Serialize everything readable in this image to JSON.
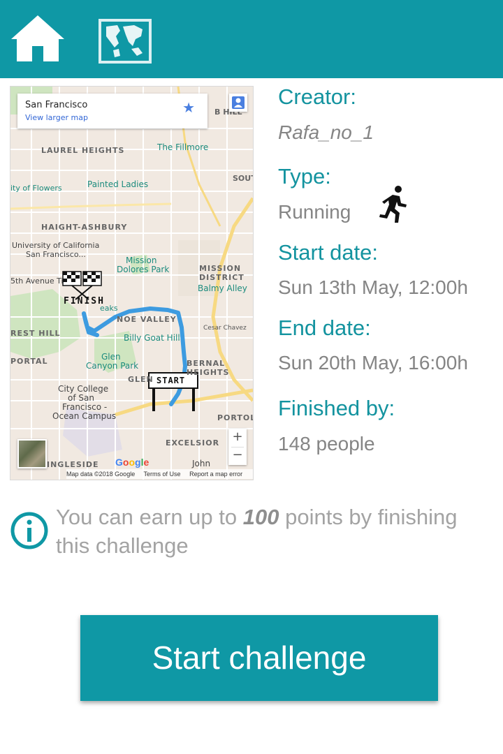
{
  "nav": {
    "home_icon": "home-icon",
    "map_icon": "world-map-icon"
  },
  "map": {
    "place_name": "San Francisco",
    "larger_map_link": "View larger map",
    "google_logo": "Google",
    "footer": {
      "data": "Map data ©2018 Google",
      "terms": "Terms of Use",
      "report": "Report a map error"
    },
    "labels": {
      "laurel_heights": "LAUREL HEIGHTS",
      "the_fillmore": "The Fillmore",
      "hill": "B HILL",
      "city_of_flowers": "ity of Flowers",
      "painted_ladies": "Painted Ladies",
      "haight_ashbury": "HAIGHT-ASHBURY",
      "ucsf": "University of California",
      "ucsf2": "San Francisco...",
      "mission_dolores": "Mission",
      "mission_dolores2": "Dolores Park",
      "mission_district": "MISSION",
      "mission_district2": "DISTRICT",
      "balmy_alley": "Balmy Alley",
      "fifth_avenue": "5th Avenue Ti",
      "noe_valley": "NOE VALLEY",
      "twin_peaks": "eaks",
      "forest_hill": "REST HILL",
      "billy_goat_hill": "Billy Goat Hill",
      "glen_canyon": "Glen",
      "glen_canyon2": "Canyon Park",
      "bernal_heights": "BERNAL HEIGHTS",
      "glen_park": "GLEN",
      "portal": "PORTAL",
      "city_college": "City College",
      "city_college2": "of San",
      "city_college3": "Francisco -",
      "city_college4": "Ocean Campus",
      "excelsior": "EXCELSIOR",
      "ingleside": "INGLESIDE",
      "john": "John",
      "portola": "PORTOL",
      "finish": "FINISH",
      "start": "START",
      "sout": "SOUT",
      "cesar": "Cesar Chavez"
    },
    "route_color": "#3d9be0"
  },
  "details": {
    "creator_label": "Creator:",
    "creator_value": "Rafa_no_1",
    "type_label": "Type:",
    "type_value": "Running",
    "type_icon": "running-person-icon",
    "start_label": "Start date:",
    "start_value": "Sun 13th May, 12:00h",
    "end_label": "End date:",
    "end_value": "Sun 20th May, 16:00h",
    "finished_label": "Finished by:",
    "finished_value": "148 people"
  },
  "note": {
    "icon": "info-icon",
    "prefix": "You can earn up to ",
    "points": "100",
    "suffix": " points by finishing this challenge"
  },
  "actions": {
    "start_label": "Start challenge"
  },
  "colors": {
    "accent": "#0f98a5",
    "label": "#13939f",
    "value": "#858585"
  }
}
